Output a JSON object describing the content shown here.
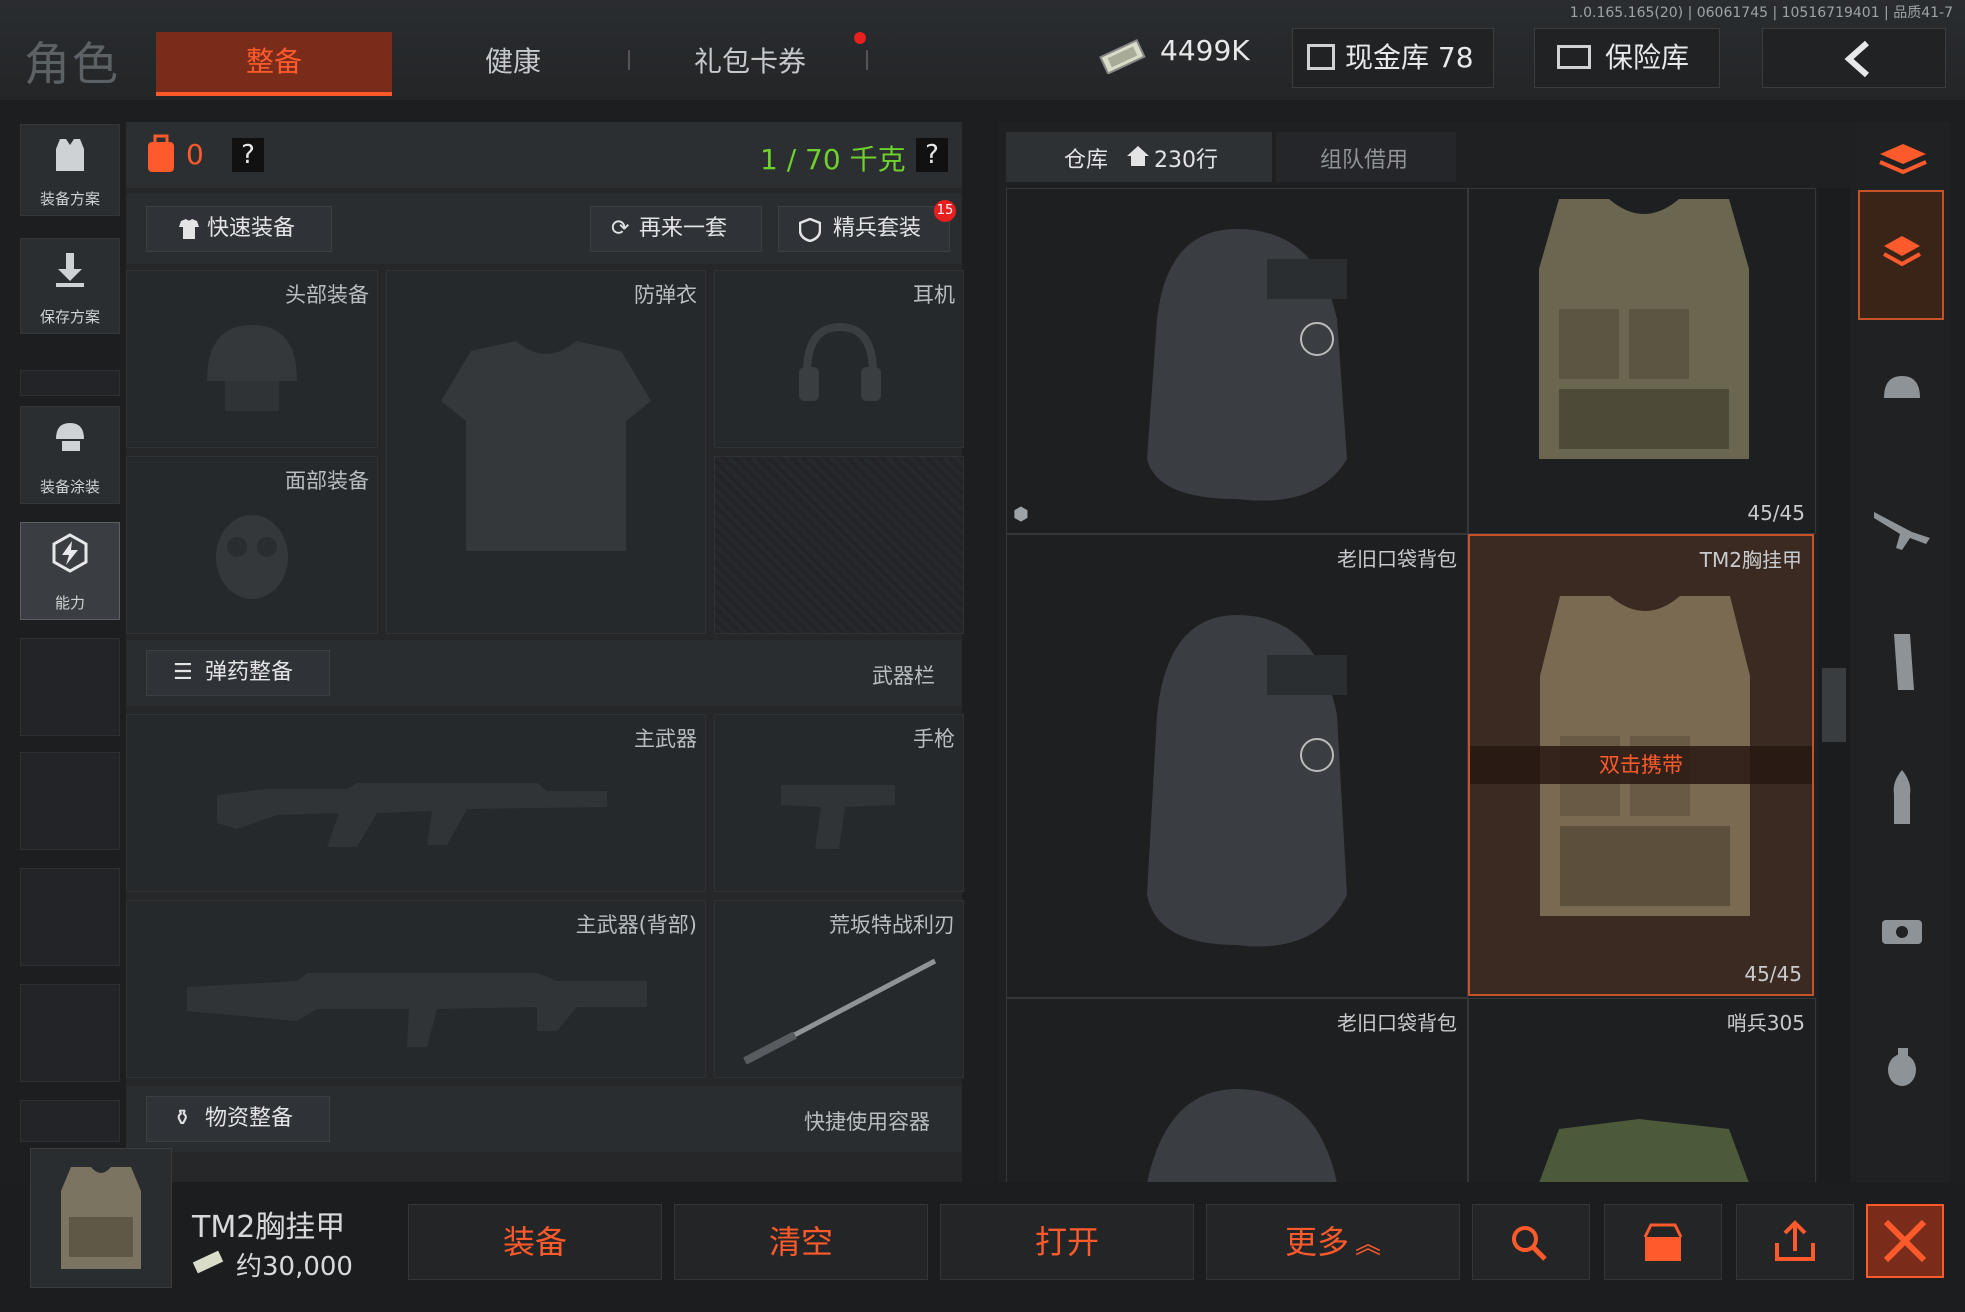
{
  "header": {
    "version_text": "1.0.165.165(20) | 06061745 | 10516719401 | 品质41-7",
    "title": "角色",
    "tabs": [
      {
        "label": "整备",
        "active": true
      },
      {
        "label": "健康",
        "active": false
      },
      {
        "label": "礼包卡券",
        "active": false
      }
    ],
    "currency": "4499K",
    "cash_vault": "现金库 78",
    "safe_box": "保险库"
  },
  "left_nav": [
    {
      "label": "装备方案",
      "icon": "vest-plan-icon"
    },
    {
      "label": "保存方案",
      "icon": "save-arrow-icon"
    },
    {
      "label": "装备涂装",
      "icon": "helmet-paint-icon"
    },
    {
      "label": "能力",
      "icon": "lightning-icon"
    }
  ],
  "loadout": {
    "backpack_count": "0",
    "help": "?",
    "weight": "1 / 70 千克",
    "quick_equip": "快速装备",
    "again_set": "再来一套",
    "elite_set": "精兵套装",
    "elite_badge": "15",
    "slots": {
      "head": "头部装备",
      "armor": "防弹衣",
      "headset": "耳机",
      "face": "面部装备",
      "primary": "主武器",
      "pistol": "手枪",
      "primary_back": "主武器(背部)",
      "melee": "荒坂特战利刃"
    },
    "ammo_button": "弹药整备",
    "weapon_bar": "武器栏",
    "supply_button": "物资整备",
    "quick_container": "快捷使用容器"
  },
  "storage": {
    "tab_warehouse": "仓库",
    "warehouse_rows": "230行",
    "tab_team": "组队借用",
    "items": [
      {
        "name": "",
        "count": ""
      },
      {
        "name": "",
        "count": "45/45"
      },
      {
        "name": "老旧口袋背包",
        "count": ""
      },
      {
        "name": "TM2胸挂甲",
        "count": "45/45",
        "hint": "双击携带"
      },
      {
        "name": "老旧口袋背包",
        "count": ""
      },
      {
        "name": "哨兵305",
        "count": ""
      }
    ]
  },
  "selected": {
    "name": "TM2胸挂甲",
    "price": "约30,000"
  },
  "actions": {
    "equip": "装备",
    "clear": "清空",
    "open": "打开",
    "more": "更多"
  },
  "colors": {
    "accent": "#ff5a2b",
    "weight_green": "#6fd12b",
    "tab_active_bg": "#7a2c1a"
  }
}
